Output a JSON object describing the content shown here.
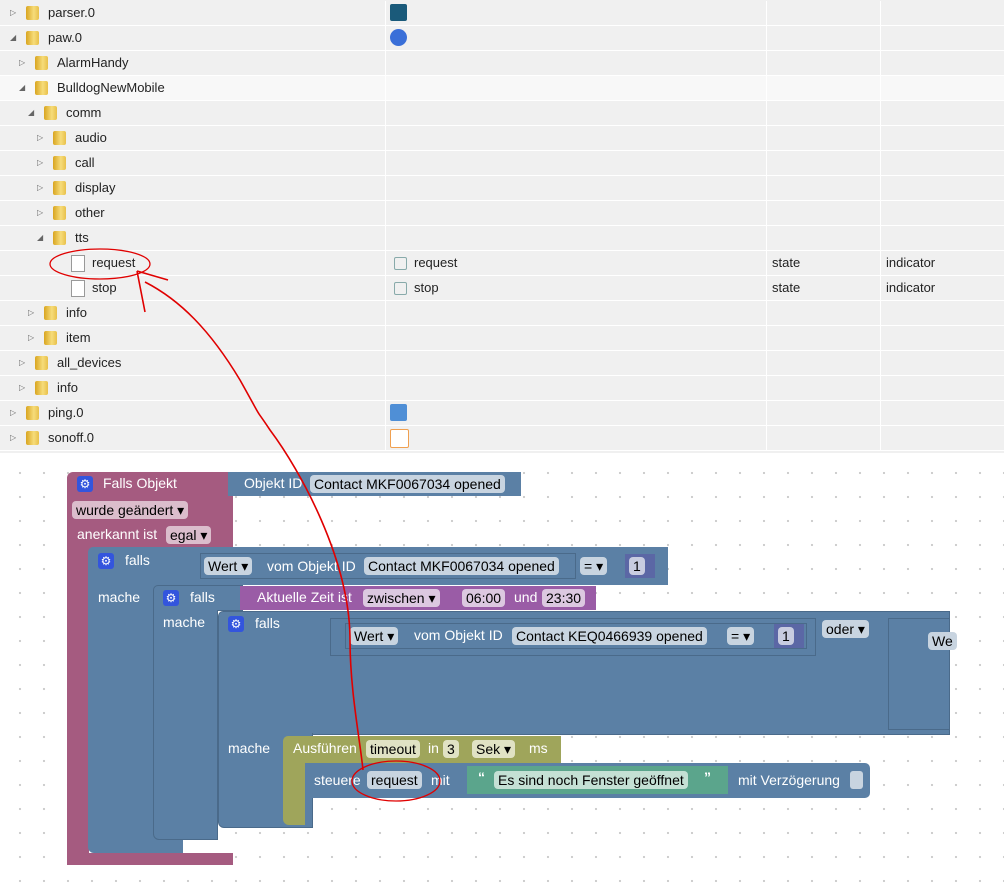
{
  "tree": {
    "rows": [
      {
        "label": "parser.0",
        "indent": 0,
        "toggle": "collapsed",
        "type": "folder",
        "icon": "parser-adapter-icon"
      },
      {
        "label": "paw.0",
        "indent": 0,
        "toggle": "expanded",
        "type": "folder",
        "icon": "paw-adapter-icon"
      },
      {
        "label": "AlarmHandy",
        "indent": 1,
        "toggle": "collapsed",
        "type": "folder"
      },
      {
        "label": "BulldogNewMobile",
        "indent": 1,
        "toggle": "expanded",
        "type": "folder",
        "highlight": true
      },
      {
        "label": "comm",
        "indent": 2,
        "toggle": "expanded",
        "type": "folder"
      },
      {
        "label": "audio",
        "indent": 3,
        "toggle": "collapsed",
        "type": "folder"
      },
      {
        "label": "call",
        "indent": 3,
        "toggle": "collapsed",
        "type": "folder"
      },
      {
        "label": "display",
        "indent": 3,
        "toggle": "collapsed",
        "type": "folder"
      },
      {
        "label": "other",
        "indent": 3,
        "toggle": "collapsed",
        "type": "folder"
      },
      {
        "label": "tts",
        "indent": 3,
        "toggle": "expanded",
        "type": "folder"
      },
      {
        "label": "request",
        "indent": 4,
        "toggle": "",
        "type": "file",
        "name": "request",
        "role": "state",
        "type2": "indicator"
      },
      {
        "label": "stop",
        "indent": 4,
        "toggle": "",
        "type": "file",
        "name": "stop",
        "role": "state",
        "type2": "indicator"
      },
      {
        "label": "info",
        "indent": 2,
        "toggle": "collapsed",
        "type": "folder"
      },
      {
        "label": "item",
        "indent": 2,
        "toggle": "collapsed",
        "type": "folder"
      },
      {
        "label": "all_devices",
        "indent": 1,
        "toggle": "collapsed",
        "type": "folder"
      },
      {
        "label": "info",
        "indent": 1,
        "toggle": "collapsed",
        "type": "folder"
      },
      {
        "label": "ping.0",
        "indent": 0,
        "toggle": "collapsed",
        "type": "folder",
        "icon": "ping-adapter-icon"
      },
      {
        "label": "sonoff.0",
        "indent": 0,
        "toggle": "collapsed",
        "type": "folder",
        "icon": "sonoff-adapter-icon"
      }
    ]
  },
  "blocks": {
    "trigger": {
      "title": "Falls Objekt",
      "objekt_id": "Objekt ID",
      "object": "Contact MKF0067034 opened",
      "event": "wurde geändert",
      "ack_label": "anerkannt ist",
      "ack": "egal",
      "color": "#a55b80"
    },
    "if1": {
      "falls": "falls",
      "mache": "mache",
      "wert": "Wert",
      "vom": "vom Objekt ID",
      "object": "Contact MKF0067034 opened",
      "op": "=",
      "value": "1"
    },
    "if2": {
      "falls": "falls",
      "mache": "mache",
      "zeit": "Aktuelle Zeit ist",
      "mode": "zwischen",
      "from": "06:00",
      "und": "und",
      "to": "23:30"
    },
    "if3": {
      "falls": "falls",
      "mache": "mache",
      "wert": "Wert",
      "vom": "vom Objekt ID",
      "object": "Contact KEQ0466939 opened",
      "op": "=",
      "value": "1",
      "oder": "oder",
      "wert2": "We"
    },
    "timeout": {
      "label": "Ausführen",
      "name": "timeout",
      "in": "in",
      "delay": "3",
      "unit": "Sek",
      "ms": "ms"
    },
    "control": {
      "label": "steuere",
      "target": "request",
      "mit": "mit",
      "open_quote": "“",
      "text": "Es sind noch Fenster geöffnet",
      "close_quote": "”",
      "delay_label": "mit Verzögerung"
    }
  },
  "colors": {
    "logic": "#5b80a5",
    "trigger": "#a55b80",
    "time": "#a55ba5",
    "timeout": "#a5a55b",
    "text": "#5ba58c",
    "annotation": "#e00000"
  }
}
